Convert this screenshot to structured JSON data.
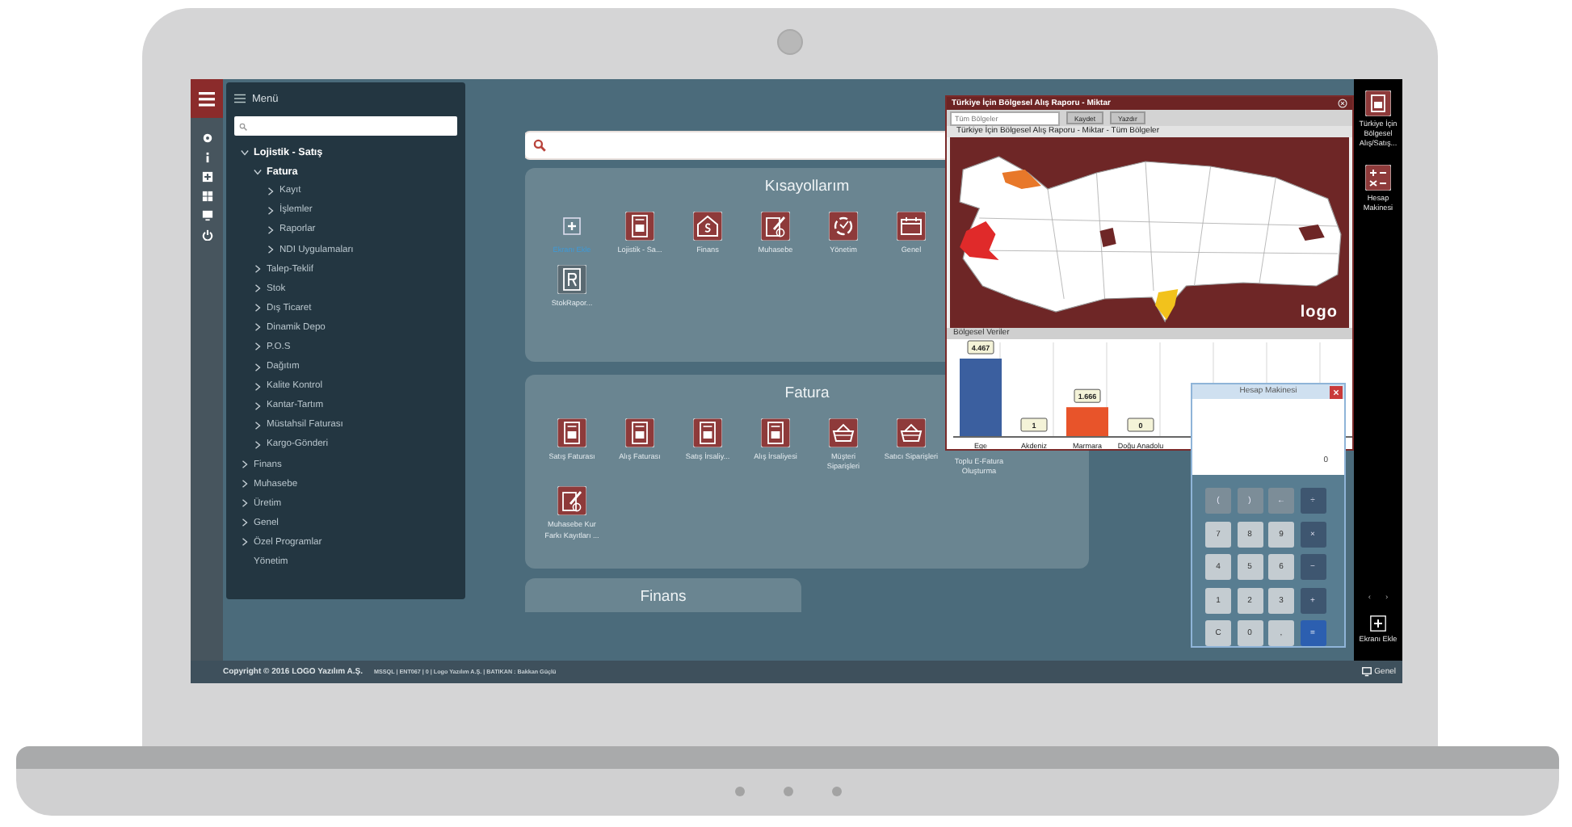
{
  "menu": {
    "title": "Menü",
    "tree": [
      {
        "label": "Lojistik - Satış",
        "kind": "folder",
        "expanded": true,
        "children": [
          {
            "label": "Fatura",
            "kind": "folder",
            "expanded": true,
            "children": [
              {
                "label": "Kayıt",
                "kind": "folder",
                "expanded": false
              },
              {
                "label": "İşlemler",
                "kind": "folder",
                "expanded": false
              },
              {
                "label": "Raporlar",
                "kind": "folder",
                "expanded": false
              },
              {
                "label": "NDI Uygulamaları",
                "kind": "folder",
                "expanded": false
              }
            ]
          },
          {
            "label": "Talep-Teklif",
            "kind": "folder",
            "expanded": false
          },
          {
            "label": "Stok",
            "kind": "folder",
            "expanded": false
          },
          {
            "label": "Dış Ticaret",
            "kind": "folder",
            "expanded": false
          },
          {
            "label": "Dinamik Depo",
            "kind": "folder",
            "expanded": false
          },
          {
            "label": "P.O.S",
            "kind": "folder",
            "expanded": false
          },
          {
            "label": "Dağıtım",
            "kind": "folder",
            "expanded": false
          },
          {
            "label": "Kalite Kontrol",
            "kind": "folder",
            "expanded": false
          },
          {
            "label": "Kantar-Tartım",
            "kind": "folder",
            "expanded": false
          },
          {
            "label": "Müstahsil Faturası",
            "kind": "folder",
            "expanded": false
          },
          {
            "label": "Kargo-Gönderi",
            "kind": "folder",
            "expanded": false
          }
        ]
      },
      {
        "label": "Finans",
        "kind": "folder",
        "expanded": false
      },
      {
        "label": "Muhasebe",
        "kind": "folder",
        "expanded": false
      },
      {
        "label": "Üretim",
        "kind": "folder",
        "expanded": false
      },
      {
        "label": "Genel",
        "kind": "folder",
        "expanded": false
      },
      {
        "label": "Özel Programlar",
        "kind": "folder",
        "expanded": false
      },
      {
        "label": "Yönetim",
        "kind": "leaf"
      }
    ]
  },
  "panels": [
    {
      "title": "Kısayollarım",
      "items": [
        {
          "label": "Ekranı Ekle",
          "kind": "add"
        },
        {
          "label": "Lojistik - Sa...",
          "kind": "invoice"
        },
        {
          "label": "Finans",
          "kind": "finance"
        },
        {
          "label": "Muhasebe",
          "kind": "ledger"
        },
        {
          "label": "Yönetim",
          "kind": "admin"
        },
        {
          "label": "Genel",
          "kind": "calendar"
        },
        {
          "label": "StokRapor...",
          "kind": "report"
        }
      ]
    },
    {
      "title": "Fatura",
      "items": [
        {
          "label": "Satış Faturası",
          "kind": "invoice"
        },
        {
          "label": "Alış Faturası",
          "kind": "invoice"
        },
        {
          "label": "Satış İrsaliy...",
          "kind": "invoice"
        },
        {
          "label": "Alış İrsaliyesi",
          "kind": "invoice"
        },
        {
          "label": "Müşteri Siparişleri",
          "kind": "basket"
        },
        {
          "label": "Satıcı Siparişleri",
          "kind": "basket"
        },
        {
          "label": "Toplu E-Fatura Oluşturma",
          "kind": "none"
        },
        {
          "label": "Muhasebe Kur Farkı Kayıtları ...",
          "kind": "ledger"
        }
      ]
    },
    {
      "title": "Finans"
    }
  ],
  "report_window": {
    "title": "Türkiye İçin Bölgesel Alış Raporu - Miktar",
    "region_select": {
      "value": "Tüm Bölgeler"
    },
    "buttons": [
      "Kaydet",
      "Yazdır"
    ],
    "subtitle": "Türkiye İçin Bölgesel Alış Raporu - Miktar - Tüm Bölgeler",
    "map_logo": "logo",
    "section_title": "Bölgesel Veriler",
    "chart_data": {
      "type": "bar",
      "categories": [
        "Ege",
        "Akdeniz",
        "Marmara",
        "Doğu Anadolu"
      ],
      "series": [
        {
          "color": "#3b5f9f",
          "values": [
            4467,
            1,
            null,
            0
          ],
          "value_labels": [
            "4.467",
            "1",
            null,
            "0"
          ]
        },
        {
          "color": "#e8542a",
          "values": [
            null,
            null,
            1666,
            null
          ],
          "value_labels": [
            null,
            null,
            "1.666",
            null
          ]
        }
      ],
      "data_labels": true
    }
  },
  "calculator": {
    "title": "Hesap Makinesi",
    "display": "0",
    "keys": [
      {
        "label": "(",
        "kind": "func"
      },
      {
        "label": ")",
        "kind": "func"
      },
      {
        "label": "←",
        "kind": "func"
      },
      {
        "label": "÷",
        "kind": "op"
      },
      {
        "label": "7",
        "kind": "digit"
      },
      {
        "label": "8",
        "kind": "digit"
      },
      {
        "label": "9",
        "kind": "digit"
      },
      {
        "label": "×",
        "kind": "op"
      },
      {
        "label": "4",
        "kind": "digit"
      },
      {
        "label": "5",
        "kind": "digit"
      },
      {
        "label": "6",
        "kind": "digit"
      },
      {
        "label": "−",
        "kind": "op"
      },
      {
        "label": "1",
        "kind": "digit"
      },
      {
        "label": "2",
        "kind": "digit"
      },
      {
        "label": "3",
        "kind": "digit"
      },
      {
        "label": "+",
        "kind": "op"
      },
      {
        "label": "C",
        "kind": "digit"
      },
      {
        "label": "0",
        "kind": "digit"
      },
      {
        "label": ",",
        "kind": "digit"
      },
      {
        "label": "=",
        "kind": "equals"
      }
    ]
  },
  "right_bar": {
    "widgets": [
      {
        "label": "Türkiye İçin Bölgesel Alış/Satış...",
        "kind": "report"
      },
      {
        "label": "Hesap Makinesi",
        "kind": "calculator"
      }
    ],
    "nav": [
      "‹",
      "›"
    ],
    "add_label": "Ekranı Ekle"
  },
  "status_bar": {
    "copyright": "Copyright © 2016 LOGO Yazılım A.Ş.",
    "info": "MSSQL | ENT067 | 0 | Logo Yazılım A.Ş. | BATIKAN : Bakkan Güçlü",
    "workspace": "Genel"
  }
}
